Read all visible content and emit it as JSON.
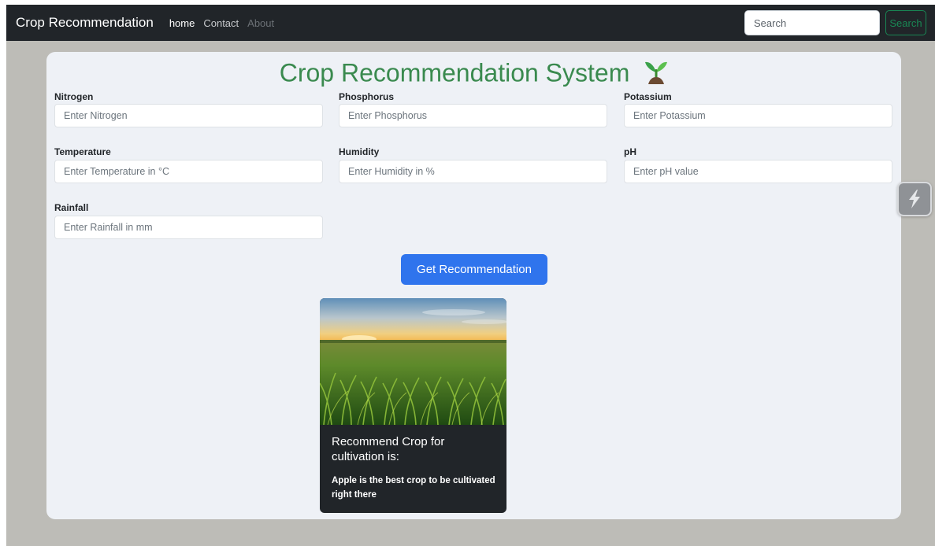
{
  "navbar": {
    "brand": "Crop Recommendation",
    "links": [
      {
        "label": "home",
        "state": "active"
      },
      {
        "label": "Contact",
        "state": "normal"
      },
      {
        "label": "About",
        "state": "disabled"
      }
    ],
    "search": {
      "placeholder": "Search",
      "value": ""
    },
    "search_button": "Search"
  },
  "main": {
    "title": "Crop Recommendation System",
    "title_icon": "sprout-icon",
    "fields": {
      "nitrogen": {
        "label": "Nitrogen",
        "placeholder": "Enter Nitrogen"
      },
      "phosphorus": {
        "label": "Phosphorus",
        "placeholder": "Enter Phosphorus"
      },
      "potassium": {
        "label": "Potassium",
        "placeholder": "Enter Potassium"
      },
      "temperature": {
        "label": "Temperature",
        "placeholder": "Enter Temperature in °C"
      },
      "humidity": {
        "label": "Humidity",
        "placeholder": "Enter Humidity in %"
      },
      "ph": {
        "label": "pH",
        "placeholder": "Enter pH value"
      },
      "rainfall": {
        "label": "Rainfall",
        "placeholder": "Enter Rainfall in mm"
      }
    },
    "button": "Get Recommendation"
  },
  "result": {
    "image": "crop-field-image",
    "title": "Recommend Crop for cultivation is:",
    "text": "Apple is the best crop to be cultivated right there"
  },
  "widget": {
    "icon": "lightning-icon"
  },
  "colors": {
    "navbar_bg": "#212529",
    "page_bg": "#bdbcb7",
    "card_bg": "#eef1f6",
    "title_green": "#3a8a4f",
    "primary_blue": "#2f74ed",
    "search_green": "#198754",
    "result_bg": "#212529"
  }
}
